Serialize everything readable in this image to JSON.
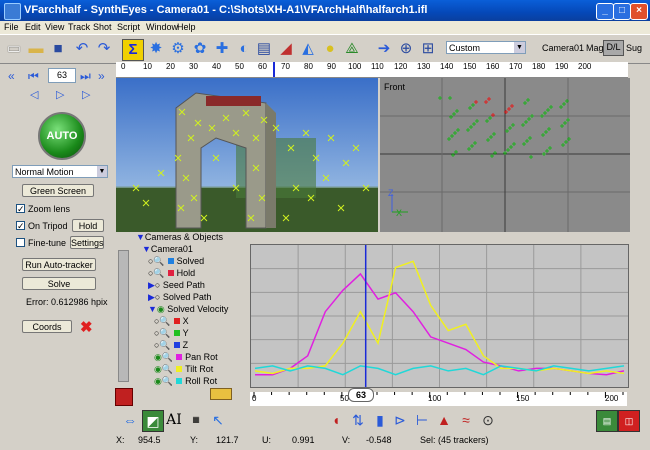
{
  "window": {
    "title": "VFarchhalf - SynthEyes - Camera01 - C:\\Shots\\XH-A1\\VFArchHalf\\halfarch1.ifl",
    "minimize": "_",
    "maximize": "□",
    "close": "×"
  },
  "menu": [
    "File",
    "Edit",
    "View",
    "Track",
    "Shot",
    "Script",
    "Window",
    "Help"
  ],
  "toolbar": {
    "view_select": "Custom",
    "camera_label": "Camera01",
    "mag_label": "Mag",
    "dl_label": "D/L",
    "sug_label": "Sug"
  },
  "frame_control": {
    "frame": "63"
  },
  "left_panel": {
    "auto_label": "AUTO",
    "motion_select": "Normal Motion",
    "green_screen": "Green Screen",
    "zoom_lens": "Zoom lens",
    "on_tripod": "On Tripod",
    "hold": "Hold",
    "fine_tune": "Fine-tune",
    "settings": "Settings",
    "run_autotracker": "Run Auto-tracker",
    "solve": "Solve",
    "error": "Error: 0.612986 hpix",
    "coords": "Coords"
  },
  "ruler": {
    "ticks": [
      "0",
      "10",
      "20",
      "30",
      "40",
      "50",
      "60",
      "70",
      "80",
      "90",
      "100",
      "110",
      "120",
      "130",
      "140",
      "150",
      "160",
      "170",
      "180",
      "190",
      "200"
    ]
  },
  "front_view": {
    "label": "Front",
    "axis_z": "Z",
    "axis_x": "X"
  },
  "tree": {
    "root": "Cameras & Objects",
    "camera": "Camera01",
    "items": [
      "Solved",
      "Hold",
      "Seed Path",
      "Solved Path",
      "Solved Velocity",
      "X",
      "Y",
      "Z",
      "Pan Rot",
      "Tilt Rot",
      "Roll Rot"
    ]
  },
  "graph": {
    "frame_marker": "63",
    "axis_ticks": [
      "0",
      "50",
      "100",
      "150",
      "200"
    ],
    "colors": {
      "pan": "#e020e0",
      "tilt": "#f0f020",
      "roll": "#20d8d8",
      "marker": "#1a2ad8"
    },
    "chart_data": {
      "type": "line",
      "x": [
        0,
        10,
        20,
        30,
        40,
        50,
        60,
        70,
        80,
        90,
        100,
        110,
        120,
        130,
        140,
        150,
        160,
        170,
        180,
        190,
        200,
        210
      ],
      "series": [
        {
          "name": "Pan Rot",
          "values": [
            0.05,
            0.05,
            0.1,
            0.2,
            0.55,
            0.72,
            0.85,
            0.65,
            0.7,
            0.55,
            0.35,
            0.3,
            0.25,
            0.15,
            0.12,
            0.08,
            0.1,
            0.1,
            0.08,
            0.06,
            0.05,
            0.08
          ]
        },
        {
          "name": "Tilt Rot",
          "values": [
            0.08,
            0.06,
            0.1,
            0.1,
            0.12,
            0.3,
            0.55,
            0.3,
            0.9,
            0.95,
            0.6,
            0.4,
            0.45,
            0.2,
            0.1,
            0.1,
            0.08,
            0.1,
            0.08,
            0.06,
            0.08,
            0.06
          ]
        },
        {
          "name": "Roll Rot",
          "values": [
            0.1,
            0.12,
            0.08,
            0.12,
            0.1,
            0.05,
            0.12,
            0.1,
            0.05,
            0.1,
            0.12,
            0.08,
            0.1,
            0.05,
            0.12,
            0.1,
            0.08,
            0.12,
            0.1,
            0.08,
            0.1,
            0.12
          ]
        }
      ]
    }
  },
  "status": {
    "x_label": "X:",
    "x_value": "954.5",
    "y_label": "Y:",
    "y_value": "121.7",
    "u_label": "U:",
    "u_value": "0.991",
    "v_label": "V:",
    "v_value": "-0.548",
    "sel": "Sel: (45 trackers)"
  }
}
